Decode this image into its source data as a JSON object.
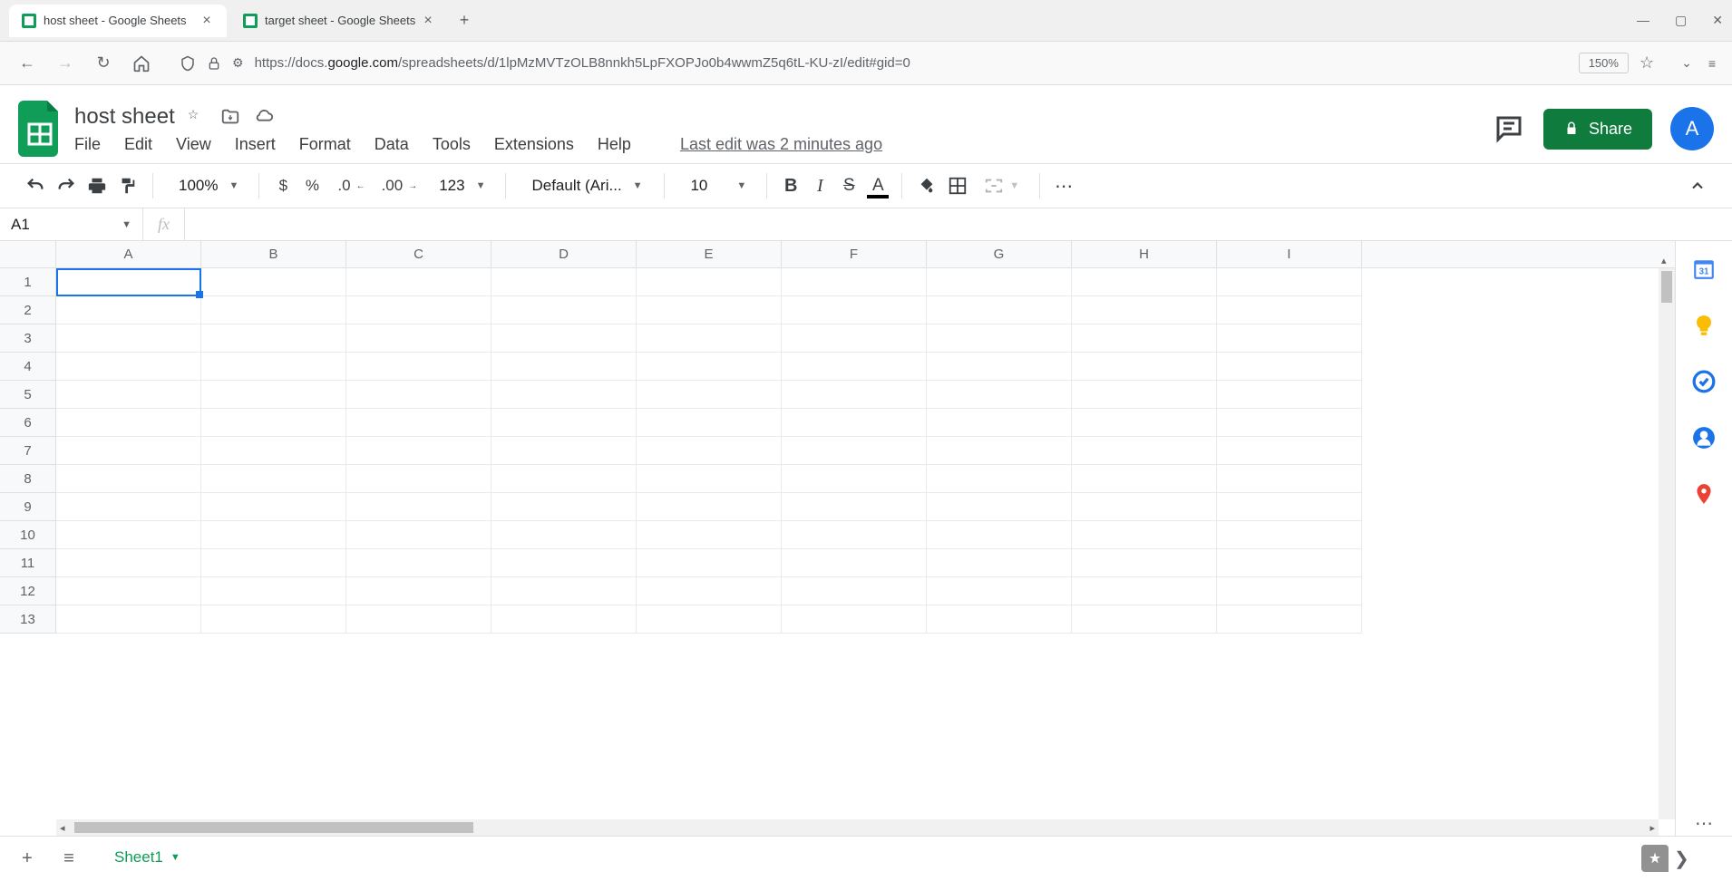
{
  "browser": {
    "tabs": [
      {
        "title": "host sheet - Google Sheets",
        "active": true
      },
      {
        "title": "target sheet - Google Sheets",
        "active": false
      }
    ],
    "url_prefix": "https://docs.",
    "url_domain": "google.com",
    "url_path": "/spreadsheets/d/1lpMzMVTzOLB8nnkh5LpFXOPJo0b4wwmZ5q6tL-KU-zI/edit#gid=0",
    "zoom": "150%"
  },
  "doc": {
    "title": "host sheet",
    "last_edit": "Last edit was 2 minutes ago"
  },
  "menus": [
    "File",
    "Edit",
    "View",
    "Insert",
    "Format",
    "Data",
    "Tools",
    "Extensions",
    "Help"
  ],
  "share_label": "Share",
  "avatar_letter": "A",
  "toolbar": {
    "zoom": "100%",
    "currency": "$",
    "percent": "%",
    "dec_dec": ".0",
    "inc_dec": ".00",
    "num_format": "123",
    "font": "Default (Ari...",
    "font_size": "10"
  },
  "name_box": "A1",
  "fx_label": "fx",
  "columns": [
    "A",
    "B",
    "C",
    "D",
    "E",
    "F",
    "G",
    "H",
    "I"
  ],
  "rows": [
    "1",
    "2",
    "3",
    "4",
    "5",
    "6",
    "7",
    "8",
    "9",
    "10",
    "11",
    "12",
    "13"
  ],
  "active_cell": {
    "row": 0,
    "col": 0
  },
  "sheet_tab": "Sheet1"
}
